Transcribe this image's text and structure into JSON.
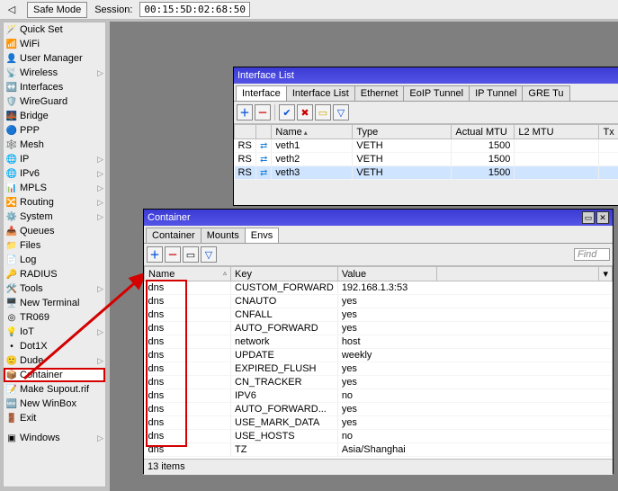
{
  "topbar": {
    "safe_mode": "Safe Mode",
    "session_label": "Session:",
    "session_value": "00:15:5D:02:68:50"
  },
  "sidebar": {
    "items": [
      {
        "icon": "🪄",
        "label": "Quick Set",
        "sub": false
      },
      {
        "icon": "📶",
        "label": "WiFi",
        "sub": false
      },
      {
        "icon": "👤",
        "label": "User Manager",
        "sub": false
      },
      {
        "icon": "📡",
        "label": "Wireless",
        "sub": true
      },
      {
        "icon": "↔️",
        "label": "Interfaces",
        "sub": false
      },
      {
        "icon": "🛡️",
        "label": "WireGuard",
        "sub": false
      },
      {
        "icon": "🌉",
        "label": "Bridge",
        "sub": false
      },
      {
        "icon": "🔵",
        "label": "PPP",
        "sub": false
      },
      {
        "icon": "🕸️",
        "label": "Mesh",
        "sub": false
      },
      {
        "icon": "🌐",
        "label": "IP",
        "sub": true
      },
      {
        "icon": "🌐",
        "label": "IPv6",
        "sub": true
      },
      {
        "icon": "📊",
        "label": "MPLS",
        "sub": true
      },
      {
        "icon": "🔀",
        "label": "Routing",
        "sub": true
      },
      {
        "icon": "⚙️",
        "label": "System",
        "sub": true
      },
      {
        "icon": "📥",
        "label": "Queues",
        "sub": false
      },
      {
        "icon": "📁",
        "label": "Files",
        "sub": false
      },
      {
        "icon": "📄",
        "label": "Log",
        "sub": false
      },
      {
        "icon": "🔑",
        "label": "RADIUS",
        "sub": false
      },
      {
        "icon": "🛠️",
        "label": "Tools",
        "sub": true
      },
      {
        "icon": "🖥️",
        "label": "New Terminal",
        "sub": false
      },
      {
        "icon": "◎",
        "label": "TR069",
        "sub": false
      },
      {
        "icon": "💡",
        "label": "IoT",
        "sub": true
      },
      {
        "icon": "•",
        "label": "Dot1X",
        "sub": false
      },
      {
        "icon": "🙂",
        "label": "Dude",
        "sub": true
      },
      {
        "icon": "📦",
        "label": "Container",
        "sub": false,
        "highlight": true
      },
      {
        "icon": "📝",
        "label": "Make Supout.rif",
        "sub": false
      },
      {
        "icon": "🆕",
        "label": "New WinBox",
        "sub": false
      },
      {
        "icon": "🚪",
        "label": "Exit",
        "sub": false
      }
    ],
    "windows": {
      "icon": "▣",
      "label": "Windows",
      "sub": true
    }
  },
  "iface_window": {
    "title": "Interface List",
    "tabs": [
      "Interface",
      "Interface List",
      "Ethernet",
      "EoIP Tunnel",
      "IP Tunnel",
      "GRE Tu"
    ],
    "columns": [
      "",
      "",
      "Name",
      "Type",
      "Actual MTU",
      "L2 MTU",
      "Tx"
    ],
    "rows": [
      {
        "flag": "RS",
        "name": "veth1",
        "type": "VETH",
        "mtu": "1500",
        "l2": "",
        "tx": ""
      },
      {
        "flag": "RS",
        "name": "veth2",
        "type": "VETH",
        "mtu": "1500",
        "l2": "",
        "tx": ""
      },
      {
        "flag": "RS",
        "name": "veth3",
        "type": "VETH",
        "mtu": "1500",
        "l2": "",
        "tx": "",
        "selected": true
      }
    ]
  },
  "container_window": {
    "title": "Container",
    "tabs": [
      "Container",
      "Mounts",
      "Envs"
    ],
    "active_tab": 2,
    "toolbar": {
      "find": "Find"
    },
    "columns": [
      "Name",
      "Key",
      "Value"
    ],
    "rows": [
      {
        "name": "dns",
        "key": "CUSTOM_FORWARD",
        "value": "192.168.1.3:53"
      },
      {
        "name": "dns",
        "key": "CNAUTO",
        "value": "yes"
      },
      {
        "name": "dns",
        "key": "CNFALL",
        "value": "yes"
      },
      {
        "name": "dns",
        "key": "AUTO_FORWARD",
        "value": "yes"
      },
      {
        "name": "dns",
        "key": "network",
        "value": "host"
      },
      {
        "name": "dns",
        "key": "UPDATE",
        "value": "weekly"
      },
      {
        "name": "dns",
        "key": "EXPIRED_FLUSH",
        "value": "yes"
      },
      {
        "name": "dns",
        "key": "CN_TRACKER",
        "value": "yes"
      },
      {
        "name": "dns",
        "key": "IPV6",
        "value": "no"
      },
      {
        "name": "dns",
        "key": "AUTO_FORWARD...",
        "value": "yes"
      },
      {
        "name": "dns",
        "key": "USE_MARK_DATA",
        "value": "yes"
      },
      {
        "name": "dns",
        "key": "USE_HOSTS",
        "value": "no"
      },
      {
        "name": "dns",
        "key": "TZ",
        "value": "Asia/Shanghai"
      }
    ],
    "status": "13 items"
  }
}
